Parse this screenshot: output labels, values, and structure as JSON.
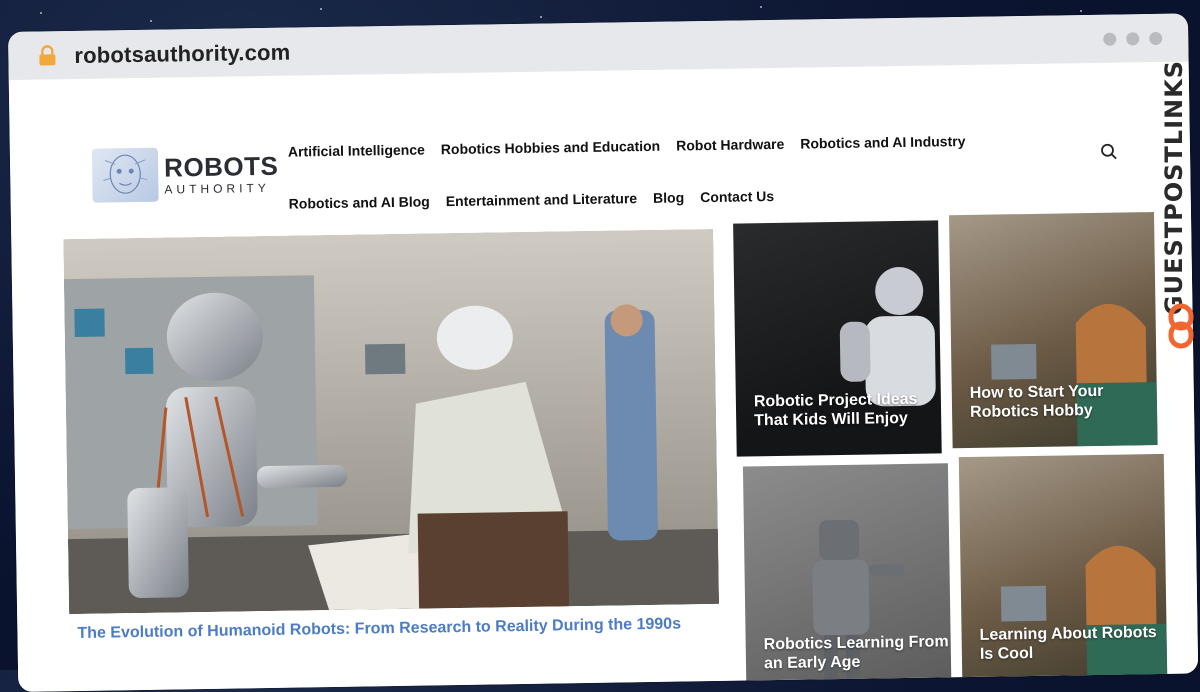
{
  "browser": {
    "url": "robotsauthority.com"
  },
  "site": {
    "logo": {
      "main": "ROBOTS",
      "sub": "AUTHORITY"
    },
    "nav": {
      "row1": [
        "Artificial Intelligence",
        "Robotics Hobbies and Education",
        "Robot Hardware",
        "Robotics and AI Industry"
      ],
      "row2": [
        "Robotics and AI Blog",
        "Entertainment and Literature",
        "Blog",
        "Contact Us"
      ]
    },
    "hero": {
      "title": "The Evolution of Humanoid Robots: From Research to Reality During the 1990s"
    },
    "cards": [
      {
        "title": "Robotic Project Ideas That Kids Will Enjoy"
      },
      {
        "title": "How to Start Your Robotics Hobby"
      },
      {
        "title": "Robotics Learning From an Early Age"
      },
      {
        "title": "Learning About Robots Is Cool"
      }
    ]
  },
  "watermark": {
    "text": "GUESTPOSTLINKS"
  },
  "colors": {
    "accent": "#4c7cc4",
    "lock": "#f2a93b",
    "watermark_orange": "#f0662e"
  }
}
